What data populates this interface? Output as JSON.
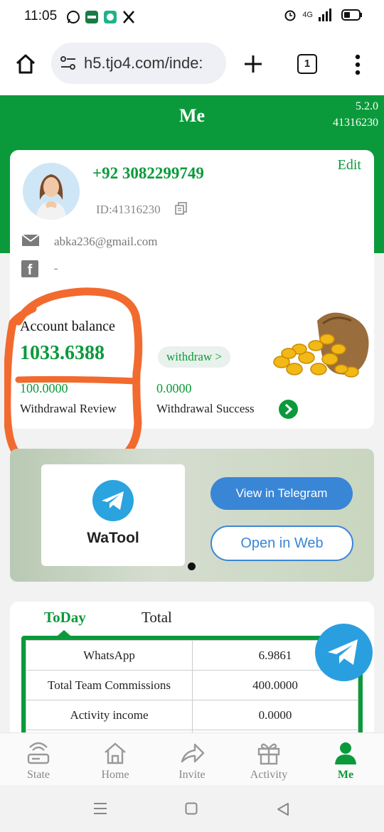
{
  "status_bar": {
    "time": "11:05",
    "network": "4G",
    "icons": [
      "whatsapp-icon",
      "wabiz-icon",
      "chat-icon",
      "x-icon",
      "alarm-icon",
      "signal-icon",
      "battery-icon"
    ]
  },
  "browser": {
    "url": "h5.tjo4.com/inde:",
    "tab_count": "1",
    "icons": [
      "home-icon",
      "site-settings-icon",
      "new-tab-icon",
      "tabs-icon",
      "menu-icon"
    ]
  },
  "header": {
    "title": "Me",
    "version": "5.2.0",
    "user_code": "41316230"
  },
  "profile": {
    "phone": "+92 3082299749",
    "edit_label": "Edit",
    "id_text": "ID:41316230",
    "email": "abka236@gmail.com",
    "facebook": "-"
  },
  "balance": {
    "label": "Account balance",
    "value": "1033.6388",
    "withdraw_label": "withdraw >",
    "review_value": "100.0000",
    "review_label": "Withdrawal Review",
    "success_value": "0.0000",
    "success_label": "Withdrawal Success"
  },
  "banner": {
    "brand": "WaTool",
    "view_telegram": "View in Telegram",
    "open_web": "Open in Web"
  },
  "stats": {
    "tabs": [
      "ToDay",
      "Total"
    ],
    "active_tab": "ToDay",
    "rows": [
      {
        "name": "WhatsApp",
        "value": "6.9861"
      },
      {
        "name": "Total Team Commissions",
        "value": "400.0000"
      },
      {
        "name": "Activity income",
        "value": "0.0000"
      }
    ]
  },
  "bottom_nav": [
    {
      "label": "State",
      "icon": "router-icon"
    },
    {
      "label": "Home",
      "icon": "home-icon"
    },
    {
      "label": "Invite",
      "icon": "share-icon"
    },
    {
      "label": "Activity",
      "icon": "gift-icon"
    },
    {
      "label": "Me",
      "icon": "person-icon"
    }
  ],
  "colors": {
    "brand_green": "#0b9a3b",
    "telegram_blue": "#2aa3df",
    "annotation_orange": "#f26a2e"
  }
}
